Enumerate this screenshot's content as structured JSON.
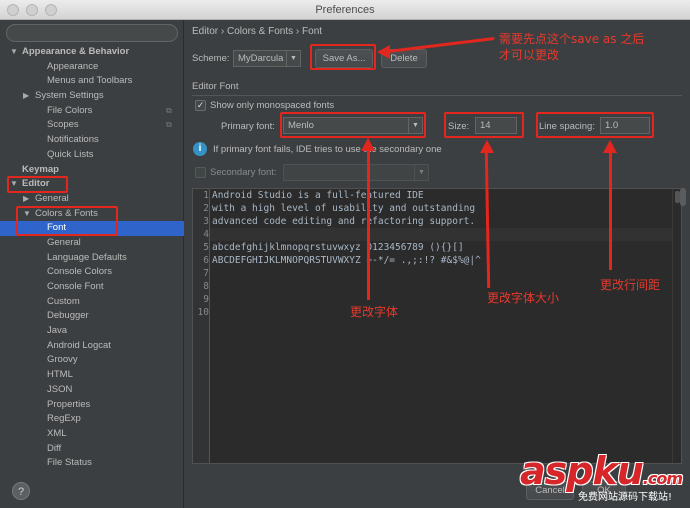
{
  "window": {
    "title": "Preferences"
  },
  "sidebar": {
    "search_value": "",
    "items": [
      {
        "label": "Appearance & Behavior",
        "arrow": "▼",
        "level": 0,
        "bold": true
      },
      {
        "label": "Appearance",
        "level": 2
      },
      {
        "label": "Menus and Toolbars",
        "level": 2
      },
      {
        "label": "System Settings",
        "arrow": "▶",
        "level": 1
      },
      {
        "label": "File Colors",
        "level": 2,
        "cfg": "⧉"
      },
      {
        "label": "Scopes",
        "level": 2,
        "cfg": "⧉"
      },
      {
        "label": "Notifications",
        "level": 2
      },
      {
        "label": "Quick Lists",
        "level": 2
      },
      {
        "label": "Keymap",
        "level": 0,
        "bold": true
      },
      {
        "label": "Editor",
        "arrow": "▼",
        "level": 0,
        "bold": true
      },
      {
        "label": "General",
        "arrow": "▶",
        "level": 1
      },
      {
        "label": "Colors & Fonts",
        "arrow": "▼",
        "level": 1
      },
      {
        "label": "Font",
        "level": 2,
        "selected": true
      },
      {
        "label": "General",
        "level": 2
      },
      {
        "label": "Language Defaults",
        "level": 2
      },
      {
        "label": "Console Colors",
        "level": 2
      },
      {
        "label": "Console Font",
        "level": 2
      },
      {
        "label": "Custom",
        "level": 2
      },
      {
        "label": "Debugger",
        "level": 2
      },
      {
        "label": "Java",
        "level": 2
      },
      {
        "label": "Android Logcat",
        "level": 2
      },
      {
        "label": "Groovy",
        "level": 2
      },
      {
        "label": "HTML",
        "level": 2
      },
      {
        "label": "JSON",
        "level": 2
      },
      {
        "label": "Properties",
        "level": 2
      },
      {
        "label": "RegExp",
        "level": 2
      },
      {
        "label": "XML",
        "level": 2
      },
      {
        "label": "Diff",
        "level": 2
      },
      {
        "label": "File Status",
        "level": 2
      }
    ],
    "help_label": "?"
  },
  "main": {
    "breadcrumb": "Editor › Colors & Fonts › Font",
    "scheme_label": "Scheme:",
    "scheme_value": "MyDarcula",
    "save_as_label": "Save As...",
    "delete_label": "Delete",
    "section_title": "Editor Font",
    "monospaced_label": "Show only monospaced fonts",
    "monospaced_checked": true,
    "primary_font_label": "Primary font:",
    "primary_font_value": "Menlo",
    "size_label": "Size:",
    "size_value": "14",
    "line_spacing_label": "Line spacing:",
    "line_spacing_value": "1.0",
    "info_text": "If primary font fails, IDE tries to use the secondary one",
    "secondary_font_label": "Secondary font:",
    "secondary_font_value": "",
    "preview_lines": [
      "Android Studio is a full-featured IDE",
      "with a high level of usability and outstanding",
      "advanced code editing and refactoring support.",
      "",
      "abcdefghijklmnopqrstuvwxyz 0123456789 (){}[]",
      "ABCDEFGHIJKLMNOPQRSTUVWXYZ +-*/= .,;:!? #&$%@|^",
      "",
      "",
      "",
      ""
    ],
    "line_numbers": [
      "1",
      "2",
      "3",
      "4",
      "5",
      "6",
      "7",
      "8",
      "9",
      "10"
    ]
  },
  "footer": {
    "cancel_label": "Cancel",
    "ok_label": "OK"
  },
  "annotations": {
    "save_as_note_1": "需要先点这个save as 之后",
    "save_as_note_2": "才可以更改",
    "font_note": "更改字体",
    "size_note": "更改字体大小",
    "spacing_note": "更改行间距"
  },
  "watermark": {
    "main": "aspku",
    "suffix": ".com",
    "sub": "免费网站源码下载站!"
  },
  "colors": {
    "annotation_red": "#e3261e",
    "selection": "#2f65ca",
    "panel": "#3c3f41",
    "editor_bg": "#2b2b2b"
  }
}
